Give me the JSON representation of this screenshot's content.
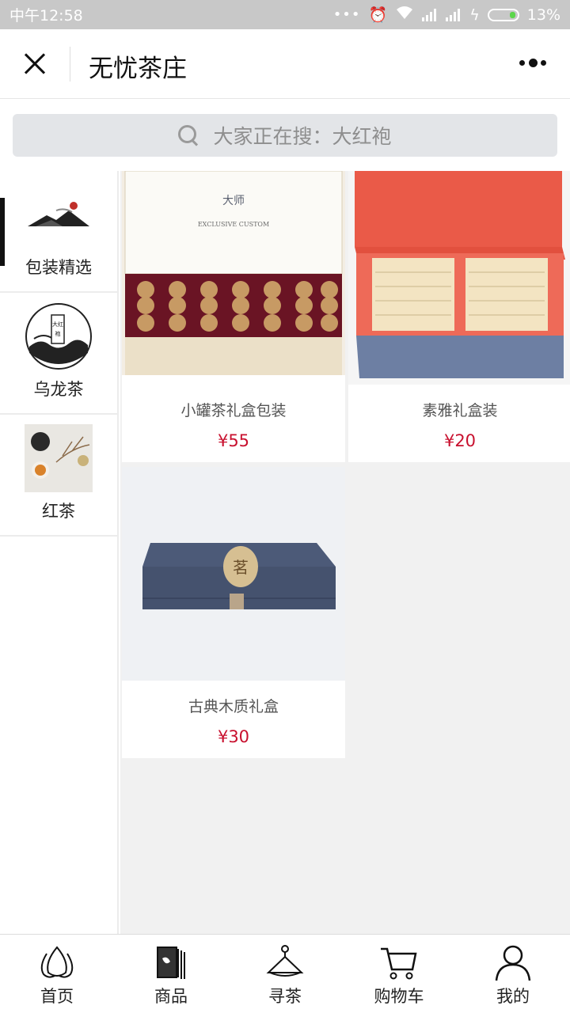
{
  "status_bar": {
    "time": "中午12:58",
    "battery": "13%"
  },
  "title_bar": {
    "title": "无忧茶庄"
  },
  "search": {
    "placeholder": "大家正在搜：大红袍"
  },
  "categories": [
    {
      "label": "包装精选",
      "active": true
    },
    {
      "label": "乌龙茶",
      "active": false
    },
    {
      "label": "红茶",
      "active": false
    }
  ],
  "products": [
    {
      "name": "小罐茶礼盒包装",
      "price": "¥55"
    },
    {
      "name": "素雅礼盒装",
      "price": "¥20"
    },
    {
      "name": "古典木质礼盒",
      "price": "¥30"
    }
  ],
  "tabs": [
    {
      "label": "首页",
      "icon": "lotus-icon"
    },
    {
      "label": "商品",
      "icon": "books-icon"
    },
    {
      "label": "寻茶",
      "icon": "hanger-icon"
    },
    {
      "label": "购物车",
      "icon": "cart-icon"
    },
    {
      "label": "我的",
      "icon": "user-icon"
    }
  ],
  "colors": {
    "price": "#c8102e",
    "status_bar": "#c8c8c8",
    "battery_fill": "#5cd64b"
  }
}
